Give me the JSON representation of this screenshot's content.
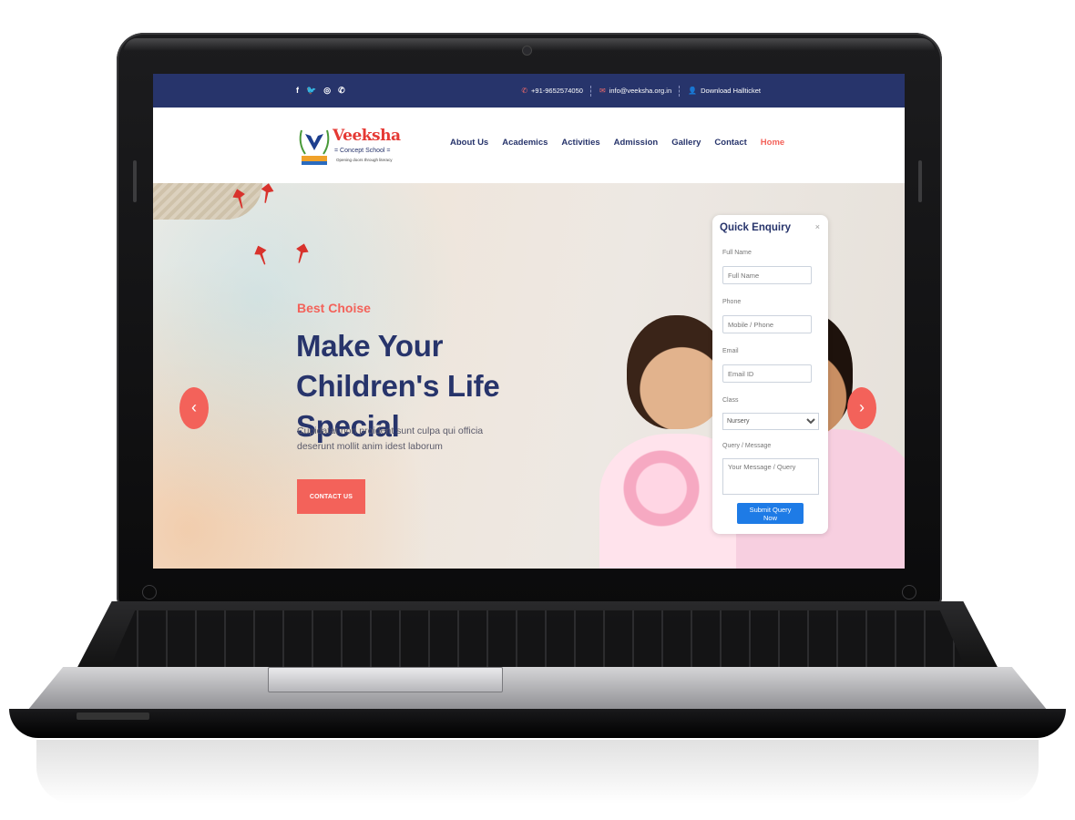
{
  "topbar": {
    "social_icons": [
      "facebook-icon",
      "twitter-icon",
      "instagram-icon",
      "whatsapp-icon"
    ],
    "phone": "+91-9652574050",
    "email": "info@veeksha.org.in",
    "hallticket": "Download Hallticket"
  },
  "brand": {
    "name": "Veeksha",
    "sub": "Concept School",
    "tagline": "Opening doors through literacy"
  },
  "nav": {
    "items": [
      "About Us",
      "Academics",
      "Activities",
      "Admission",
      "Gallery",
      "Contact",
      "Home"
    ],
    "active": "Home"
  },
  "hero": {
    "eyebrow": "Best Choise",
    "headline": "Make Your Children's Life Special",
    "body": "Cupidatat non proident sunt culpa qui officia deserunt mollit anim idest laborum",
    "cta": "CONTACT US",
    "prev": "‹",
    "next": "›"
  },
  "enquiry": {
    "title": "Quick Enquiry",
    "close": "×",
    "fields": {
      "name_label": "Full Name",
      "name_placeholder": "Full Name",
      "phone_label": "Phone",
      "phone_placeholder": "Mobile / Phone",
      "email_label": "Email",
      "email_placeholder": "Email ID",
      "class_label": "Class",
      "class_value": "Nursery",
      "message_label": "Query / Message",
      "message_placeholder": "Your Message / Query"
    },
    "submit": "Submit Query Now"
  },
  "colors": {
    "navy": "#27346b",
    "coral": "#f3625a",
    "submit_blue": "#1e7be6"
  }
}
